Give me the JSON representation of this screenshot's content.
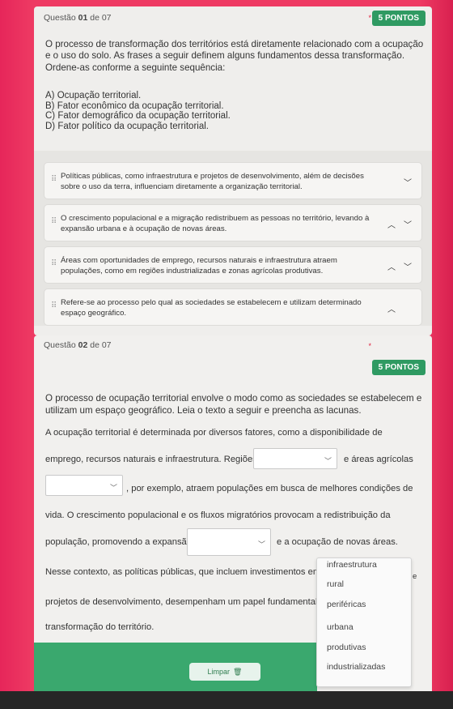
{
  "q1": {
    "label_prefix": "Questão ",
    "label_num": "01",
    "label_suffix": " de 07",
    "required": "*",
    "points": "5 PONTOS",
    "statement1": "O processo de transformação dos territórios está diretamente relacionado com a ocupação e o uso do solo. As frases a seguir definem alguns fundamentos dessa transformação.",
    "statement2": "Ordene-as conforme a seguinte sequência:",
    "options": [
      "A) Ocupação territorial.",
      "B) Fator econômico da ocupação territorial.",
      "C) Fator demográfico da ocupação territorial.",
      "D) Fator político da ocupação territorial."
    ],
    "items": [
      "Políticas públicas, como infraestrutura e projetos de desenvolvimento, além de decisões sobre o uso da terra, influenciam diretamente a organização territorial.",
      "O crescimento populacional e a migração redistribuem as pessoas no território, levando à expansão urbana e à ocupação de novas áreas.",
      "Áreas com oportunidades de emprego, recursos naturais e infraestrutura atraem populações, como em regiões industrializadas e zonas agrícolas produtivas.",
      "Refere-se ao processo pelo qual as sociedades se estabelecem e utilizam determinado espaço geográfico."
    ]
  },
  "q2": {
    "label_prefix": "Questão ",
    "label_num": "02",
    "label_suffix": " de 07",
    "required": "*",
    "points": "5 PONTOS",
    "statement": "O processo de ocupação territorial envolve o modo como as sociedades se estabelecem e utilizam um espaço geográfico. Leia o texto a seguir e preencha as lacunas.",
    "line1": "A ocupação territorial é determinada por diversos fatores, como a disponibilidade de",
    "line2a": "emprego, recursos naturais e infraestrutura. Regiões",
    "line2b": "e áreas agrícolas",
    "line3b": ", por exemplo, atraem populações em busca de melhores condições de",
    "line4": "vida. O crescimento populacional e os fluxos migratórios provocam a redistribuição da",
    "line5a": "população, promovendo a expansão",
    "line5b": "e a ocupação de novas áreas.",
    "line6a": "Nesse contexto, as políticas públicas, que incluem investimentos em",
    "line6b": "e",
    "line7": "projetos de desenvolvimento, desempenham um papel fundamental n",
    "line8": "transformação do território.",
    "dropdown_options": [
      "infraestrutura",
      "rural",
      "periféricas",
      "urbana",
      "produtivas",
      "industrializadas"
    ]
  },
  "footer": {
    "clear_label": "Limpar"
  }
}
